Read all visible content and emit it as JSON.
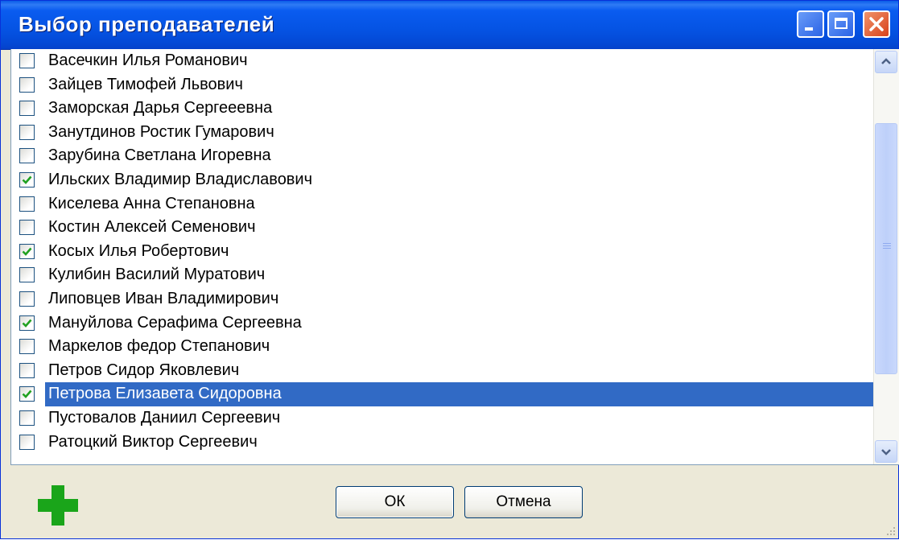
{
  "window": {
    "title": "Выбор преподавателей"
  },
  "list": {
    "items": [
      {
        "label": "Васечкин Илья Романович",
        "checked": false,
        "selected": false
      },
      {
        "label": "Зайцев Тимофей Львович",
        "checked": false,
        "selected": false
      },
      {
        "label": "Заморская Дарья Сергееевна",
        "checked": false,
        "selected": false
      },
      {
        "label": "Занутдинов Ростик Гумарович",
        "checked": false,
        "selected": false
      },
      {
        "label": "Зарубина Светлана Игоревна",
        "checked": false,
        "selected": false
      },
      {
        "label": "Ильских Владимир Владиславович",
        "checked": true,
        "selected": false
      },
      {
        "label": "Киселева Анна Степановна",
        "checked": false,
        "selected": false
      },
      {
        "label": "Костин Алексей Семенович",
        "checked": false,
        "selected": false
      },
      {
        "label": "Косых Илья Робертович",
        "checked": true,
        "selected": false
      },
      {
        "label": "Кулибин Василий Муратович",
        "checked": false,
        "selected": false
      },
      {
        "label": "Липовцев Иван Владимирович",
        "checked": false,
        "selected": false
      },
      {
        "label": "Мануйлова Серафима Сергеевна",
        "checked": true,
        "selected": false
      },
      {
        "label": "Маркелов федор Степанович",
        "checked": false,
        "selected": false
      },
      {
        "label": "Петров Сидор Яковлевич",
        "checked": false,
        "selected": false
      },
      {
        "label": "Петрова Елизавета Сидоровна",
        "checked": true,
        "selected": true
      },
      {
        "label": "Пустовалов Даниил Сергеевич",
        "checked": false,
        "selected": false
      },
      {
        "label": "Ратоцкий Виктор Сергеевич",
        "checked": false,
        "selected": false
      }
    ]
  },
  "footer": {
    "ok_label": "ОК",
    "cancel_label": "Отмена",
    "add_icon": "green-plus-icon"
  },
  "colors": {
    "titlebar": "#0553e3",
    "selection": "#316ac5",
    "check": "#21a121",
    "add": "#1aa51a"
  }
}
